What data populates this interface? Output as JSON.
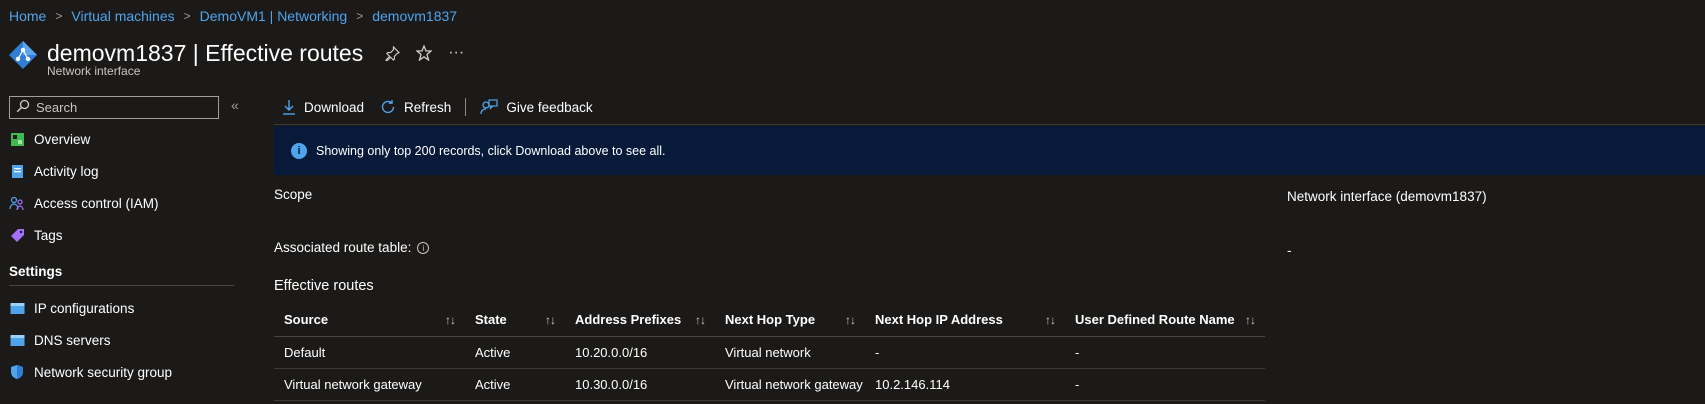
{
  "breadcrumb": [
    "Home",
    "Virtual machines",
    "DemoVM1 | Networking",
    "demovm1837"
  ],
  "header": {
    "title": "demovm1837 | Effective routes",
    "subtitle": "Network interface",
    "more_label": "···"
  },
  "sidebar": {
    "search_placeholder": "Search",
    "collapse_label": "«",
    "items": [
      {
        "label": "Overview",
        "icon": "overview-icon",
        "color": "#3fb950"
      },
      {
        "label": "Activity log",
        "icon": "activity-log-icon",
        "color": "#4fa4ec"
      },
      {
        "label": "Access control (IAM)",
        "icon": "people-icon",
        "color": "#4fa4ec"
      },
      {
        "label": "Tags",
        "icon": "tag-icon",
        "color": "#a371f7"
      }
    ],
    "settings_label": "Settings",
    "settings_items": [
      {
        "label": "IP configurations",
        "icon": "ip-config-icon"
      },
      {
        "label": "DNS servers",
        "icon": "dns-icon"
      },
      {
        "label": "Network security group",
        "icon": "shield-icon"
      }
    ]
  },
  "toolbar": {
    "download_label": "Download",
    "refresh_label": "Refresh",
    "feedback_label": "Give feedback"
  },
  "info_bar": {
    "icon": "i",
    "text": "Showing only top 200 records, click Download above to see all."
  },
  "scope": {
    "label": "Scope",
    "value": "Network interface (demovm1837)"
  },
  "route_table": {
    "label": "Associated route table:",
    "help_icon": "i",
    "value": "-"
  },
  "effective_routes": {
    "title": "Effective routes",
    "sort_glyph": "↑↓",
    "columns": [
      "Source",
      "State",
      "Address Prefixes",
      "Next Hop Type",
      "Next Hop IP Address",
      "User Defined Route Name"
    ],
    "rows": [
      [
        "Default",
        "Active",
        "10.20.0.0/16",
        "Virtual network",
        "-",
        "-"
      ],
      [
        "Virtual network gateway",
        "Active",
        "10.30.0.0/16",
        "Virtual network gateway",
        "10.2.146.114",
        "-"
      ]
    ]
  },
  "colors": {
    "background": "#1b1a19",
    "link": "#4fa4ec",
    "info_bar": "#071a3a"
  }
}
